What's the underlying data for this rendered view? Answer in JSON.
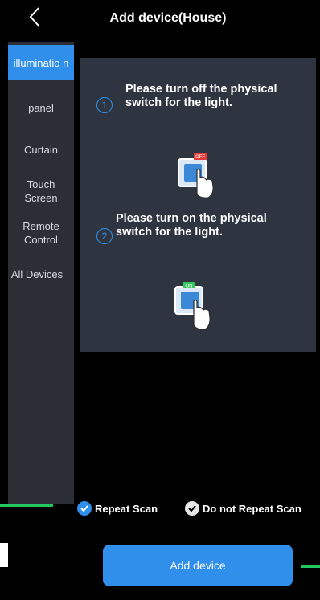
{
  "header": {
    "title": "Add device(House)",
    "back_icon": "chevron-left-icon"
  },
  "sidebar": {
    "items": [
      {
        "label": "illuminatio n",
        "active": true
      },
      {
        "label": "panel",
        "active": false
      },
      {
        "label": "Curtain",
        "active": false
      },
      {
        "label": "Touch Screen",
        "active": false
      },
      {
        "label": "Remote Control",
        "active": false
      },
      {
        "label": "All Devices",
        "active": false
      }
    ]
  },
  "steps": [
    {
      "number": "1",
      "text": "Please turn off the physical switch for the light.",
      "switch_label": "OFF"
    },
    {
      "number": "2",
      "text": "Please turn on the physical switch for the light.",
      "switch_label": "ON"
    }
  ],
  "options": {
    "repeat": "Repeat Scan",
    "no_repeat": "Do not Repeat Scan"
  },
  "action": {
    "add_label": "Add device"
  },
  "colors": {
    "accent": "#2f8fea",
    "panel": "#2e3540",
    "sidebar": "#2b2f35",
    "guide_line": "#22c55e"
  }
}
